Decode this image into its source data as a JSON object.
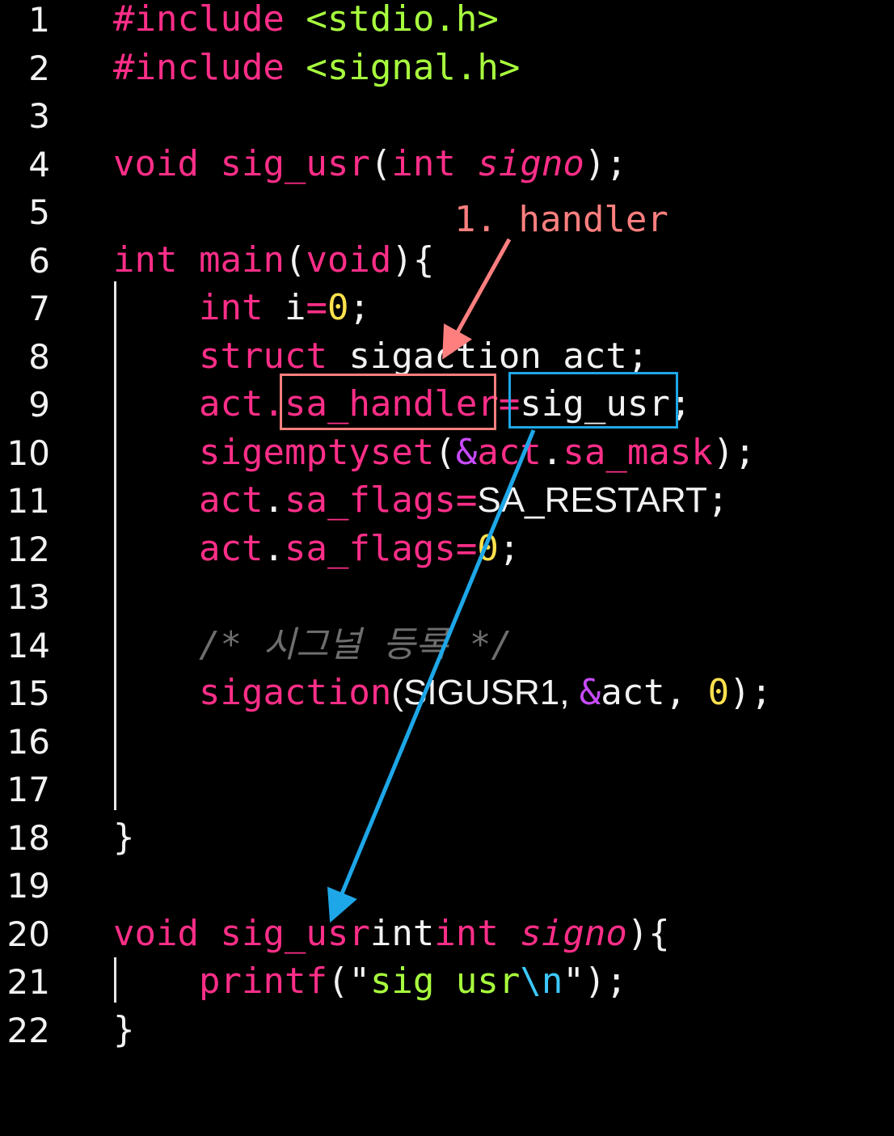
{
  "line_numbers": [
    "1",
    "2",
    "3",
    "4",
    "5",
    "6",
    "7",
    "8",
    "9",
    "10",
    "11",
    "12",
    "13",
    "14",
    "15",
    "16",
    "17",
    "18",
    "19",
    "20",
    "21",
    "22"
  ],
  "code": {
    "l1": {
      "kw": "#include",
      "sp": " ",
      "arg": "<stdio.h>"
    },
    "l2": {
      "kw": "#include",
      "sp": " ",
      "arg": "<signal.h>"
    },
    "l4": {
      "t1": "void",
      "t2": " sig_usr",
      "p1": "(",
      "t3": "int",
      "t4": " ",
      "t5": "signo",
      "p2": ");"
    },
    "l6": {
      "t1": "int",
      "t2": " main",
      "p1": "(",
      "t3": "void",
      "p2": "){"
    },
    "l7": {
      "t1": "int",
      "t2": " i",
      "t3": "=",
      "t4": "0",
      "t5": ";"
    },
    "l8": {
      "t1": "struct",
      "t2": " sigaction act;"
    },
    "l9": {
      "t1": "act.",
      "t2": "sa_handler",
      "t3": "=",
      "t4": "sig_usr",
      "t5": ";"
    },
    "l10": {
      "t1": "sigemptyset",
      "t2": "(",
      "t3": "&",
      "t4": "act",
      "t5": ".",
      "t6": "sa_mask",
      "t7": ");"
    },
    "l11": {
      "t1": "act",
      "t2": ".",
      "t3": "sa_flags",
      "t4": "=",
      "t5": "SA_RESTART",
      "t6": ";"
    },
    "l12": {
      "t1": "act",
      "t2": ".",
      "t3": "sa_flags",
      "t4": "=",
      "t5": "0",
      "t6": ";"
    },
    "l14": {
      "comment": "/* 시그널 등록 */"
    },
    "l15": {
      "t1": "sigaction",
      "t2": "(SIGUSR1, ",
      "t3": "&",
      "t4": "act",
      ", ": "",
      "t5": ", ",
      "t6": "0",
      "t7": ");"
    },
    "l18": {
      "t1": "}"
    },
    "l20": {
      "t1": "void",
      "t2": " sig_usr",
      "p1": "(",
      "t3": "int",
      "t4": " ",
      "t5": "signo",
      "p2": "){"
    },
    "l21": {
      "t1": "printf",
      "t2": "(\"",
      "t3": "sig usr",
      "t4": "\\n",
      "t5": "\");"
    },
    "l22": {
      "t1": "}"
    }
  },
  "annotation": {
    "label": "1. handler"
  },
  "colors": {
    "annotation_red": "#ff7f7f",
    "annotation_blue": "#1ea7e8",
    "keyword": "#ff2e88",
    "include_arg": "#a8ff3e",
    "number": "#ffe14d"
  }
}
